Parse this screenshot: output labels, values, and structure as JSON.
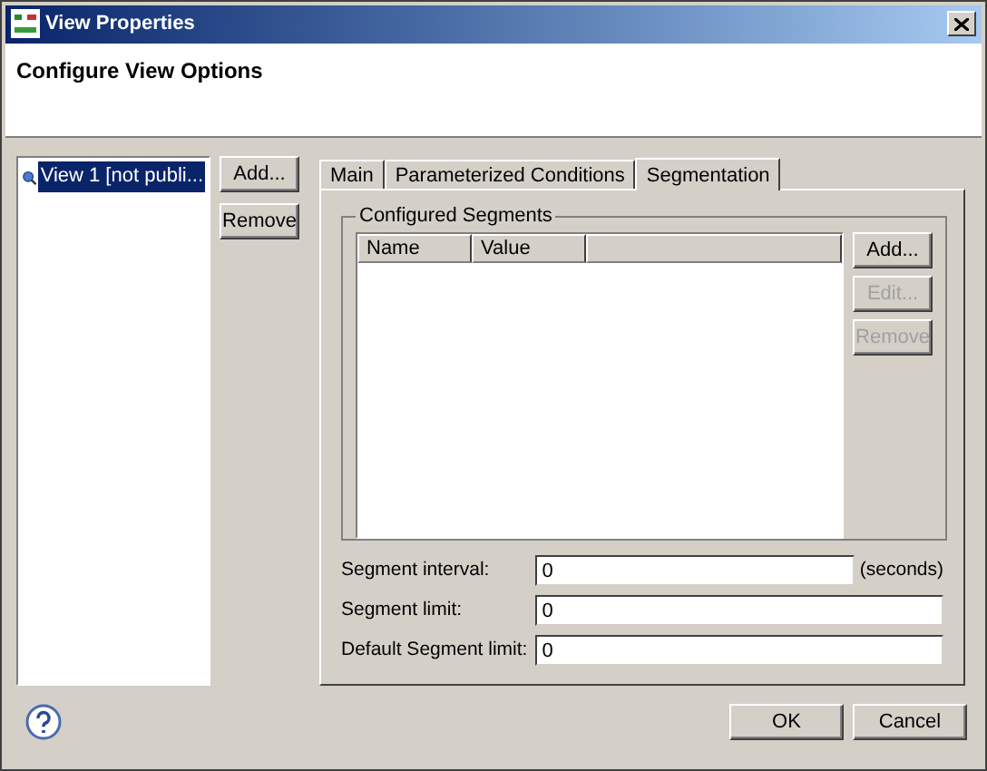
{
  "window": {
    "title": "View Properties"
  },
  "header": {
    "title": "Configure View Options"
  },
  "views": [
    {
      "label": "View 1 [not publi...",
      "selected": true
    }
  ],
  "view_buttons": [
    {
      "label": "Add...",
      "disabled": false
    },
    {
      "label": "Remove",
      "disabled": false
    }
  ],
  "tabs": [
    {
      "label": "Main",
      "selected": false
    },
    {
      "label": "Parameterized Conditions",
      "selected": false
    },
    {
      "label": "Segmentation",
      "selected": true
    }
  ],
  "group": {
    "title": "Configured Segments",
    "columns": [
      "Name",
      "Value"
    ],
    "buttons": [
      {
        "label": "Add...",
        "disabled": false
      },
      {
        "label": "Edit...",
        "disabled": true
      },
      {
        "label": "Remove",
        "disabled": true
      }
    ]
  },
  "fields": [
    {
      "label": "Segment interval:",
      "value": "0",
      "unit": "(seconds)"
    },
    {
      "label": "Segment limit:",
      "value": "0"
    },
    {
      "label": "Default Segment limit:",
      "value": "0"
    }
  ],
  "buttons": [
    "OK",
    "Cancel"
  ]
}
